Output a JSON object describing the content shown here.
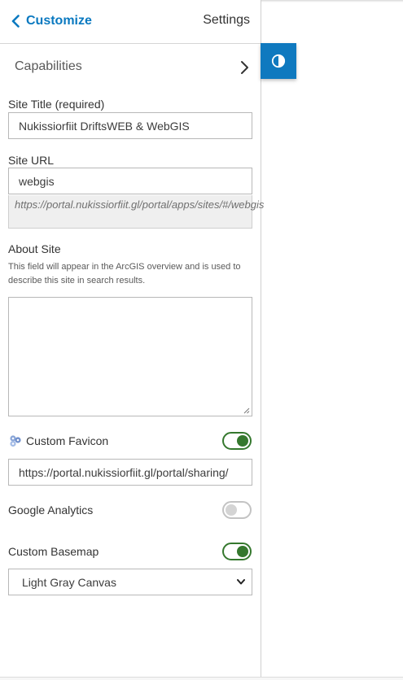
{
  "header": {
    "back_label": "Customize",
    "settings_label": "Settings"
  },
  "capabilities": {
    "label": "Capabilities"
  },
  "site_title": {
    "label": "Site Title (required)",
    "value": "Nukissiorfiit DriftsWEB & WebGIS"
  },
  "site_url": {
    "label": "Site URL",
    "value": "webgis",
    "preview": "https://portal.nukissiorfiit.gl/portal/apps/sites/#/webgis"
  },
  "about_site": {
    "label": "About Site",
    "hint": "This field will appear in the ArcGIS overview and is used to describe this site in search results.",
    "value": ""
  },
  "custom_favicon": {
    "label": "Custom Favicon",
    "enabled": true,
    "value": "https://portal.nukissiorfiit.gl/portal/sharing/"
  },
  "google_analytics": {
    "label": "Google Analytics",
    "enabled": false
  },
  "custom_basemap": {
    "label": "Custom Basemap",
    "enabled": true,
    "selected": "Light Gray Canvas"
  },
  "colors": {
    "accent": "#0f79bf",
    "toggle_on": "#35782e",
    "toggle_off": "#c3c3c3"
  }
}
